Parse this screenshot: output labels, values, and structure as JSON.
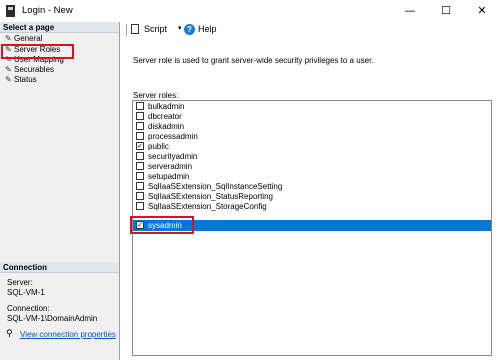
{
  "window": {
    "title": "Login - New",
    "minimize_glyph": "—",
    "maximize_glyph": "☐",
    "close_glyph": "✕"
  },
  "left_pane": {
    "select_page_header": "Select a page",
    "pages": [
      {
        "label": "General",
        "icon": "wrench-icon"
      },
      {
        "label": "Server Roles",
        "icon": "wrench-icon"
      },
      {
        "label": "User Mapping",
        "icon": "wrench-icon"
      },
      {
        "label": "Securables",
        "icon": "wrench-icon"
      },
      {
        "label": "Status",
        "icon": "wrench-icon"
      }
    ],
    "connection_header": "Connection",
    "server_label": "Server:",
    "server_value": "SQL-VM-1",
    "connection_label": "Connection:",
    "connection_value": "SQL-VM-1\\DomainAdmin",
    "view_properties_link": "View connection properties"
  },
  "toolbar": {
    "script_label": "Script",
    "help_label": "Help"
  },
  "main": {
    "description": "Server role is used to grant server-wide security privileges to a user.",
    "roles_label": "Server roles:",
    "roles": [
      {
        "name": "bulkadmin",
        "checked": false
      },
      {
        "name": "dbcreator",
        "checked": false
      },
      {
        "name": "diskadmin",
        "checked": false
      },
      {
        "name": "processadmin",
        "checked": false
      },
      {
        "name": "public",
        "checked": true
      },
      {
        "name": "securityadmin",
        "checked": false
      },
      {
        "name": "serveradmin",
        "checked": false
      },
      {
        "name": "setupadmin",
        "checked": false
      },
      {
        "name": "SqlIaaSExtension_SqlInstanceSetting",
        "checked": false
      },
      {
        "name": "SqlIaaSExtension_StatusReporting",
        "checked": false
      },
      {
        "name": "SqlIaaSExtension_StorageConfig",
        "checked": false
      },
      {
        "name": "sysadmin",
        "checked": true,
        "selected": true
      }
    ]
  },
  "colors": {
    "selection": "#0078d7",
    "highlight_box": "#e01020",
    "link": "#0b4fc9"
  }
}
